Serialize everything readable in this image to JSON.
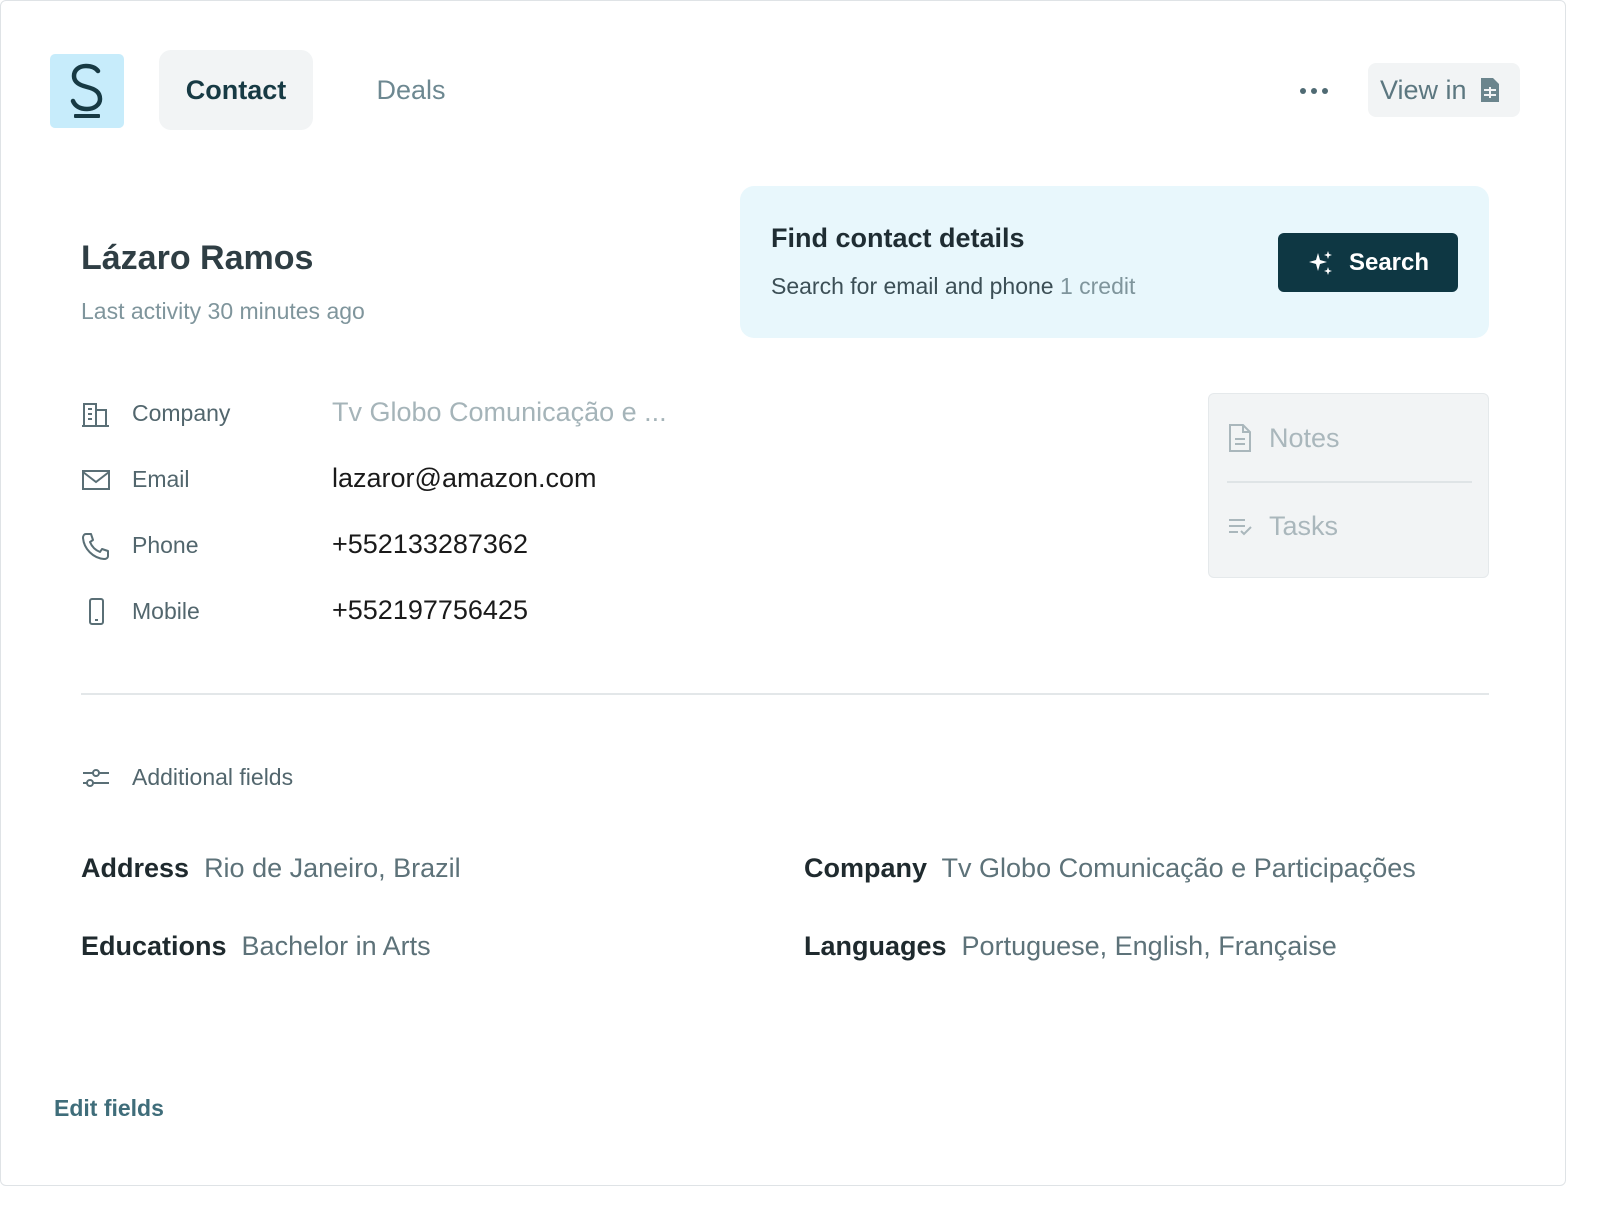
{
  "app": {
    "logo_letter": "S",
    "tabs": [
      {
        "label": "Contact",
        "active": true
      },
      {
        "label": "Deals",
        "active": false
      }
    ],
    "more_icon": "ellipsis-icon",
    "view_in_label": "View in",
    "view_in_icon": "spreadsheet-icon"
  },
  "contact": {
    "name": "Lázaro Ramos",
    "last_activity": "Last activity 30 minutes ago"
  },
  "find_panel": {
    "title": "Find contact details",
    "subtitle": "Search for email and phone",
    "credit": "1 credit",
    "button_label": "Search",
    "button_icon": "sparkles-icon"
  },
  "fields": [
    {
      "icon": "building-icon",
      "label": "Company",
      "value": "Tv Globo Comunicação e ...",
      "muted": true
    },
    {
      "icon": "envelope-icon",
      "label": "Email",
      "value": "lazaror@amazon.com",
      "muted": false
    },
    {
      "icon": "phone-icon",
      "label": "Phone",
      "value": "+552133287362",
      "muted": false
    },
    {
      "icon": "mobile-icon",
      "label": "Mobile",
      "value": "+552197756425",
      "muted": false
    }
  ],
  "side_panel": {
    "notes_label": "Notes",
    "tasks_label": "Tasks"
  },
  "additional": {
    "title": "Additional fields",
    "items": [
      {
        "key": "Address",
        "value": "Rio de Janeiro, Brazil"
      },
      {
        "key": "Company",
        "value": "Tv Globo Comunicação e Participações"
      },
      {
        "key": "Educations",
        "value": "Bachelor in Arts"
      },
      {
        "key": "Languages",
        "value": "Portuguese, English, Française"
      }
    ]
  },
  "footer": {
    "edit_label": "Edit fields"
  },
  "colors": {
    "brand_dark": "#0e3743",
    "panel_bg": "#e8f7fc",
    "logo_bg": "#c7ecfb"
  }
}
